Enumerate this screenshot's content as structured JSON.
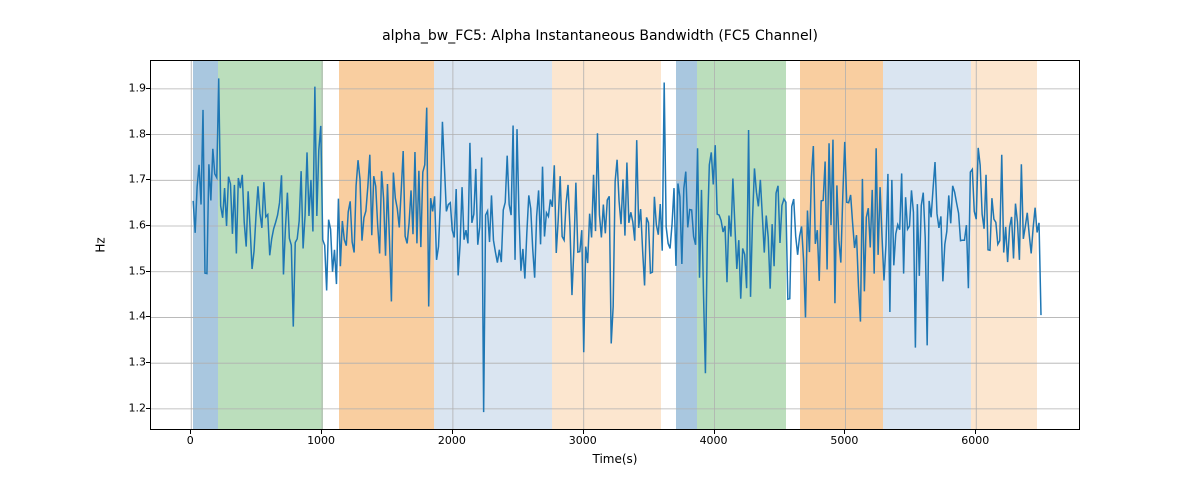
{
  "chart_data": {
    "type": "line",
    "title": "alpha_bw_FC5: Alpha Instantaneous Bandwidth (FC5 Channel)",
    "xlabel": "Time(s)",
    "ylabel": "Hz",
    "xlim": [
      -307.5,
      6785.5
    ],
    "ylim": [
      1.156,
      1.961
    ],
    "xticks": [
      0,
      1000,
      2000,
      3000,
      4000,
      5000,
      6000
    ],
    "yticks": [
      1.2,
      1.3,
      1.4,
      1.5,
      1.6,
      1.7,
      1.8,
      1.9
    ],
    "xtick_labels": [
      "0",
      "1000",
      "2000",
      "3000",
      "4000",
      "5000",
      "6000"
    ],
    "ytick_labels": [
      "1.2",
      "1.3",
      "1.4",
      "1.5",
      "1.6",
      "1.7",
      "1.8",
      "1.9"
    ],
    "bands": [
      {
        "x0": 15,
        "x1": 201,
        "color": "#a9c7df"
      },
      {
        "x0": 201,
        "x1": 1009,
        "color": "#bbdebc"
      },
      {
        "x0": 1130,
        "x1": 1857,
        "color": "#f9cea0"
      },
      {
        "x0": 1857,
        "x1": 2161,
        "color": "#dae5f1"
      },
      {
        "x0": 2161,
        "x1": 2755,
        "color": "#dae5f1"
      },
      {
        "x0": 2755,
        "x1": 3589,
        "color": "#fce6cf"
      },
      {
        "x0": 3709,
        "x1": 3868,
        "color": "#a9c7df"
      },
      {
        "x0": 3868,
        "x1": 4548,
        "color": "#bbdebc"
      },
      {
        "x0": 4655,
        "x1": 5284,
        "color": "#f9cea0"
      },
      {
        "x0": 5284,
        "x1": 5960,
        "color": "#dae5f1"
      },
      {
        "x0": 5960,
        "x1": 6463,
        "color": "#fce6cf"
      }
    ],
    "series": [
      {
        "name": "alpha_bw_FC5",
        "color": "#1f77b4",
        "x_start": 15,
        "x_step": 15,
        "values": [
          1.655,
          1.585,
          1.686,
          1.734,
          1.647,
          1.854,
          1.497,
          1.496,
          1.735,
          1.656,
          1.769,
          1.714,
          1.706,
          1.923,
          1.644,
          1.618,
          1.683,
          1.6,
          1.708,
          1.692,
          1.583,
          1.69,
          1.54,
          1.705,
          1.683,
          1.712,
          1.608,
          1.555,
          1.676,
          1.595,
          1.506,
          1.545,
          1.622,
          1.687,
          1.628,
          1.596,
          1.696,
          1.62,
          1.625,
          1.536,
          1.572,
          1.594,
          1.608,
          1.624,
          1.651,
          1.711,
          1.494,
          1.595,
          1.673,
          1.573,
          1.558,
          1.38,
          1.564,
          1.572,
          1.611,
          1.72,
          1.551,
          1.623,
          1.761,
          1.622,
          1.701,
          1.588,
          1.905,
          1.622,
          1.766,
          1.819,
          1.57,
          1.558,
          1.459,
          1.614,
          1.593,
          1.5,
          1.548,
          1.473,
          1.66,
          1.512,
          1.611,
          1.57,
          1.557,
          1.631,
          1.654,
          1.565,
          1.542,
          1.688,
          1.744,
          1.702,
          1.568,
          1.618,
          1.633,
          1.687,
          1.756,
          1.58,
          1.709,
          1.687,
          1.602,
          1.54,
          1.72,
          1.661,
          1.535,
          1.692,
          1.571,
          1.435,
          1.717,
          1.661,
          1.638,
          1.597,
          1.678,
          1.764,
          1.578,
          1.562,
          1.606,
          1.678,
          1.582,
          1.762,
          1.562,
          1.721,
          1.554,
          1.718,
          1.734,
          1.859,
          1.424,
          1.661,
          1.632,
          1.665,
          1.526,
          1.555,
          1.657,
          1.828,
          1.731,
          1.632,
          1.647,
          1.651,
          1.591,
          1.575,
          1.681,
          1.492,
          1.56,
          1.685,
          1.57,
          1.591,
          1.562,
          1.782,
          1.607,
          1.626,
          1.725,
          1.559,
          1.598,
          1.75,
          1.193,
          1.624,
          1.633,
          1.565,
          1.667,
          1.569,
          1.543,
          1.52,
          1.548,
          1.521,
          1.635,
          1.652,
          1.754,
          1.647,
          1.624,
          1.82,
          1.526,
          1.812,
          1.625,
          1.502,
          1.55,
          1.485,
          1.584,
          1.667,
          1.638,
          1.55,
          1.487,
          1.621,
          1.678,
          1.56,
          1.73,
          1.577,
          1.629,
          1.621,
          1.658,
          1.642,
          1.733,
          1.541,
          1.614,
          1.709,
          1.577,
          1.569,
          1.65,
          1.69,
          1.595,
          1.449,
          1.551,
          1.695,
          1.543,
          1.544,
          1.591,
          1.324,
          1.555,
          1.519,
          1.627,
          1.575,
          1.712,
          1.589,
          1.803,
          1.625,
          1.575,
          1.647,
          1.584,
          1.657,
          1.665,
          1.343,
          1.424,
          1.697,
          1.745,
          1.655,
          1.604,
          1.702,
          1.579,
          1.739,
          1.607,
          1.63,
          1.609,
          1.568,
          1.788,
          1.596,
          1.637,
          1.547,
          1.47,
          1.619,
          1.607,
          1.497,
          1.499,
          1.664,
          1.603,
          1.581,
          1.648,
          1.546,
          1.914,
          1.598,
          1.562,
          1.551,
          1.604,
          1.683,
          1.513,
          1.693,
          1.664,
          1.517,
          1.682,
          1.719,
          1.597,
          1.636,
          1.635,
          1.577,
          1.559,
          1.77,
          1.487,
          1.679,
          1.456,
          1.278,
          1.581,
          1.734,
          1.761,
          1.691,
          1.777,
          1.626,
          1.624,
          1.612,
          1.587,
          1.6,
          1.477,
          1.623,
          1.577,
          1.704,
          1.604,
          1.506,
          1.569,
          1.441,
          1.551,
          1.538,
          1.464,
          1.81,
          1.445,
          1.615,
          1.726,
          1.674,
          1.643,
          1.701,
          1.623,
          1.542,
          1.623,
          1.575,
          1.463,
          1.604,
          1.512,
          1.672,
          1.688,
          1.563,
          1.645,
          1.659,
          1.652,
          1.44,
          1.441,
          1.643,
          1.659,
          1.578,
          1.537,
          1.578,
          1.599,
          1.527,
          1.4,
          1.634,
          1.543,
          1.707,
          1.775,
          1.561,
          1.591,
          1.48,
          1.655,
          1.656,
          1.741,
          1.505,
          1.781,
          1.602,
          1.789,
          1.431,
          1.689,
          1.569,
          1.52,
          1.666,
          1.784,
          1.652,
          1.651,
          1.668,
          1.607,
          1.552,
          1.58,
          1.468,
          1.391,
          1.703,
          1.457,
          1.619,
          1.639,
          1.553,
          1.679,
          1.496,
          1.77,
          1.537,
          1.685,
          1.576,
          1.481,
          1.559,
          1.714,
          1.412,
          1.701,
          1.514,
          1.583,
          1.603,
          1.592,
          1.715,
          1.496,
          1.663,
          1.593,
          1.6,
          1.678,
          1.63,
          1.334,
          1.648,
          1.491,
          1.645,
          1.673,
          1.575,
          1.339,
          1.655,
          1.619,
          1.682,
          1.74,
          1.627,
          1.596,
          1.621,
          1.479,
          1.56,
          1.588,
          1.667,
          1.606,
          1.688,
          1.674,
          1.65,
          1.628,
          1.568,
          1.569,
          1.569,
          1.602,
          1.464,
          1.718,
          1.724,
          1.632,
          1.615,
          1.771,
          1.733,
          1.626,
          1.594,
          1.712,
          1.548,
          1.547,
          1.661,
          1.615,
          1.608,
          1.56,
          1.568,
          1.756,
          1.542,
          1.598,
          1.521,
          1.597,
          1.62,
          1.529,
          1.649,
          1.609,
          1.526,
          1.735,
          1.572,
          1.599,
          1.629,
          1.581,
          1.54,
          1.596,
          1.64,
          1.586,
          1.607,
          1.405
        ]
      }
    ]
  }
}
